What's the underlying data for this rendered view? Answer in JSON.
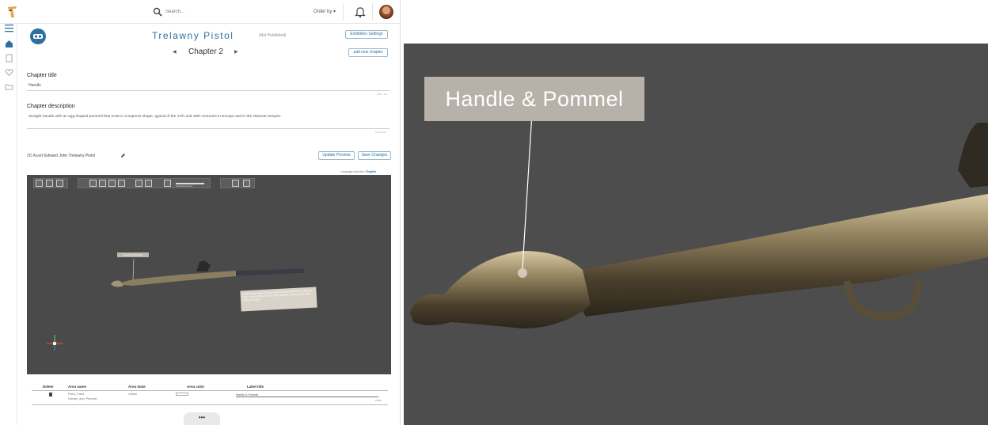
{
  "header": {
    "search_placeholder": "Search...",
    "order_by_label": "Order by ▾"
  },
  "exhibition": {
    "title": "Trelawny Pistol",
    "status": "(Not Published)",
    "settings_button": "Exhibition Settings",
    "add_chapter_button": "add new chapter"
  },
  "chapter": {
    "prev_icon": "chevron-left-icon",
    "label": "Chapter 2",
    "next_icon": "chevron-right-icon",
    "title_label": "Chapter title",
    "title_value": "Handle",
    "title_counter": "6/50 / 140",
    "description_label": "Chapter description",
    "description_value": "Straight handle with an egg-shaped pommel that ends in a bopress shape, typical of the 17th and 18th centuries in Europe and in the Ottoman Empire.",
    "description_counter": "144/1,000"
  },
  "asset": {
    "label": "3D Asset:",
    "name": "Edward John Trelawny Pistol",
    "update_preview_button": "Update Preview",
    "save_changes_button": "Save Changes",
    "language_label": "Language selection:",
    "language_value": "English"
  },
  "viewer": {
    "mini_label": "Handle & Pommel",
    "mini_note": "Straight handle with an egg-shaped pommel that ends in a bopress shape, typical of the 17th and 18th centuries in Europe and in the Ottoman Empire.",
    "slider_caption": "Transparency level"
  },
  "areas_table": {
    "headers": [
      "Delete",
      "Area name",
      "Area state",
      "Area color",
      "Label title"
    ],
    "rows": [
      {
        "name_line1": "Pistol_Parts",
        "name_line2": "Handle_and_Pommel",
        "state": "Visible",
        "label_title": "Handle & Pommel",
        "label_counter": "15/50"
      }
    ]
  },
  "more_button": "•••",
  "zoom_view": {
    "label": "Handle & Pommel"
  },
  "colors": {
    "accent": "#2c6fa0",
    "viewer_bg": "#4a4a4a",
    "label_bg": "#b7b1a9"
  }
}
